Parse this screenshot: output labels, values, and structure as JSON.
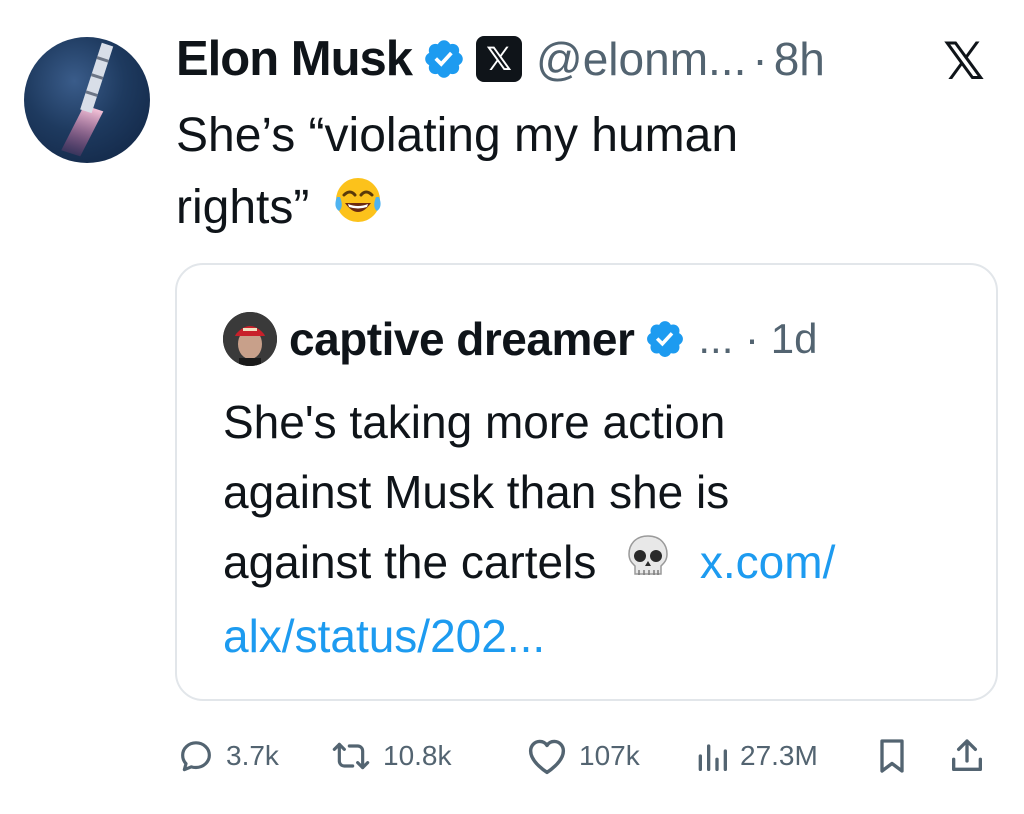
{
  "tweet": {
    "author_name": "Elon Musk",
    "handle": "@elonm...",
    "separator": "·",
    "time": "8h",
    "platform_badge": "𝕏",
    "close_glyph": "𝕏",
    "text_line1": "She’s “violating my human",
    "text_line2": "rights”",
    "emoji": "face-with-tears-of-joy"
  },
  "quote": {
    "author_name": "captive dreamer",
    "meta": "... · 1d",
    "text_line1": "She's taking more action",
    "text_line2": "against Musk than she is",
    "text_line3": "against the cartels",
    "emoji": "skull",
    "link_line1": "x.com/",
    "link_line2": "alx/status/202..."
  },
  "actions": {
    "replies": "3.7k",
    "reposts": "10.8k",
    "likes": "107k",
    "views": "27.3M"
  },
  "colors": {
    "text": "#0f1419",
    "muted": "#536471",
    "verified": "#1d9bf0",
    "link": "#1d9bf0",
    "border": "#e2e6ea"
  }
}
